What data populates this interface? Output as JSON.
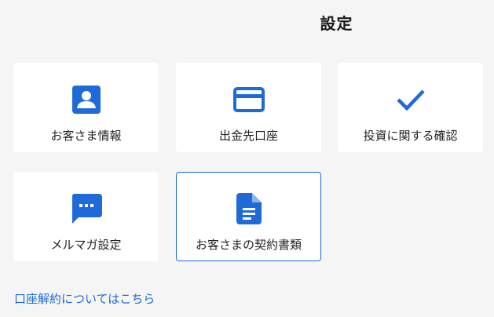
{
  "page_title": "設定",
  "accent_color": "#1e6ad8",
  "cards": [
    {
      "label": "お客さま情報",
      "icon": "account-box-icon"
    },
    {
      "label": "出金先口座",
      "icon": "credit-card-icon"
    },
    {
      "label": "投資に関する確認",
      "icon": "checkmark-icon"
    },
    {
      "label": "メルマガ設定",
      "icon": "chat-bubble-icon"
    },
    {
      "label": "お客さまの契約書類",
      "icon": "document-icon",
      "selected": true
    }
  ],
  "footer_link": "口座解約についてはこちら"
}
